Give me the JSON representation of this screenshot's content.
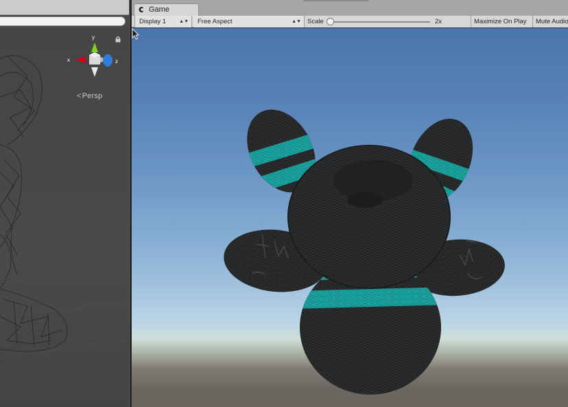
{
  "scene": {
    "axis_x": "x",
    "axis_y": "y",
    "axis_z": "z",
    "persp_label": "Persp",
    "icons": {
      "gizmo": "orientation-gizmo-icon",
      "lock": "lock-icon",
      "persp": "chevron-left-icon"
    }
  },
  "game_tab": {
    "label": "Game",
    "icon": "game-controller-icon"
  },
  "toolbar": {
    "display": "Display 1",
    "aspect": "Free Aspect",
    "scale_label": "Scale",
    "scale_value": "2x",
    "scale_slider_fraction": 0.0,
    "maximize_label": "Maximize On Play",
    "mute_label": "Mute Audio"
  },
  "colors": {
    "sky_top": "#4b75ad",
    "horizon": "#cdded9",
    "ground": "#6a635e",
    "bear_body": "#242526",
    "stripe": "#1ba3a0"
  }
}
